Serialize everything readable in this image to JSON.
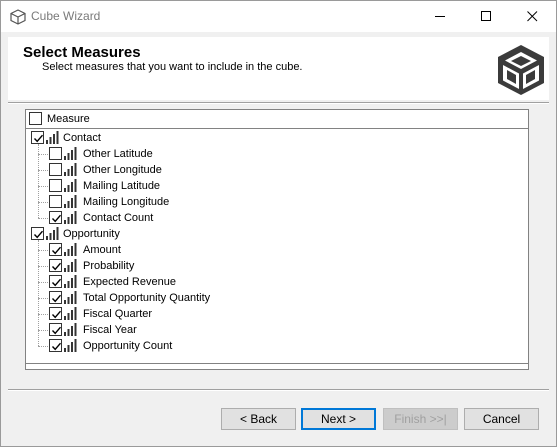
{
  "window": {
    "title": "Cube Wizard",
    "icon": "cube-icon",
    "controls": [
      "minimize-icon",
      "maximize-icon",
      "close-icon"
    ]
  },
  "header": {
    "title": "Select Measures",
    "subtitle": "Select measures that you want to include in the cube.",
    "logo": "cube-logo-icon"
  },
  "tree": {
    "root_label": "Measure",
    "root_checked": false,
    "groups": [
      {
        "label": "Contact",
        "checked": true,
        "items": [
          {
            "label": "Other Latitude",
            "checked": false
          },
          {
            "label": "Other Longitude",
            "checked": false
          },
          {
            "label": "Mailing Latitude",
            "checked": false
          },
          {
            "label": "Mailing Longitude",
            "checked": false
          },
          {
            "label": "Contact Count",
            "checked": true
          }
        ]
      },
      {
        "label": "Opportunity",
        "checked": true,
        "items": [
          {
            "label": "Amount",
            "checked": true
          },
          {
            "label": "Probability",
            "checked": true
          },
          {
            "label": "Expected Revenue",
            "checked": true
          },
          {
            "label": "Total Opportunity Quantity",
            "checked": true
          },
          {
            "label": "Fiscal Quarter",
            "checked": true
          },
          {
            "label": "Fiscal Year",
            "checked": true
          },
          {
            "label": "Opportunity Count",
            "checked": true
          }
        ]
      }
    ]
  },
  "buttons": {
    "back": "< Back",
    "next": "Next >",
    "finish": "Finish >>|",
    "cancel": "Cancel"
  },
  "colors": {
    "window_bg": "#f0f0f0",
    "accent": "#0078d7",
    "disabled_text": "#a0a0a0"
  }
}
